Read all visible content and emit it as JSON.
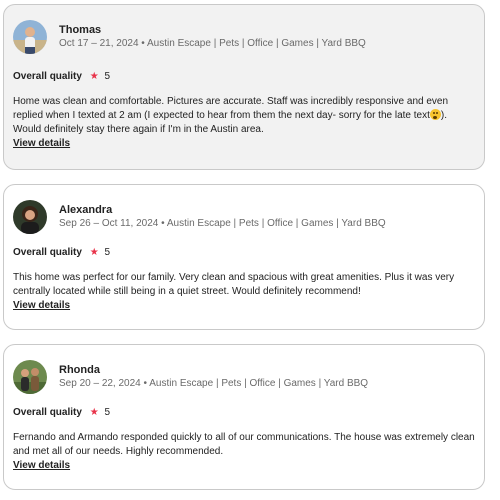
{
  "reviews": [
    {
      "name": "Thomas",
      "stay": "Oct 17 – 21, 2024 • Austin Escape | Pets | Office | Games | Yard BBQ",
      "quality_label": "Overall quality",
      "rating": "5",
      "text_before_emoji": "Home was clean and comfortable. Pictures are accurate. Staff was incredibly responsive and even replied when I texted at 2 am (I expected to hear from them the next day- sorry for the late text",
      "text_after_emoji": "). Would definitely stay there again if I'm in the Austin area.",
      "view_details": "View details"
    },
    {
      "name": "Alexandra",
      "stay": "Sep 26 – Oct 11, 2024 • Austin Escape | Pets | Office | Games | Yard BBQ",
      "quality_label": "Overall quality",
      "rating": "5",
      "text": "This home was perfect for our family. Very clean and spacious with great amenities. Plus it was very centrally located while still being in a quiet street. Would definitely recommend!",
      "view_details": "View details"
    },
    {
      "name": "Rhonda",
      "stay": "Sep 20 – 22, 2024 • Austin Escape | Pets | Office | Games | Yard BBQ",
      "quality_label": "Overall quality",
      "rating": "5",
      "text": "Fernando and Armando responded quickly to all of our communications. The house was extremely clean and met all of our needs. Highly recommended.",
      "view_details": "View details"
    }
  ],
  "icons": {
    "star": "star-icon",
    "emoji": "upside-down-face-emoji-icon"
  },
  "colors": {
    "star": "#e8334a",
    "highlight_card_bg": "#f2f2f2",
    "border": "#c9c9c9"
  }
}
